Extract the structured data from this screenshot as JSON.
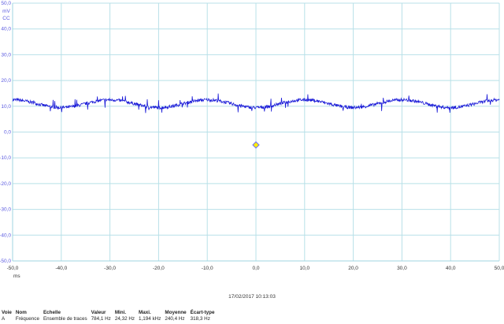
{
  "chart_data": {
    "type": "line",
    "title": "",
    "xlabel": "ms",
    "ylabel": "mV",
    "y_coupling": "CC",
    "xlim": [
      -50,
      50
    ],
    "ylim": [
      -50,
      50
    ],
    "grid": true,
    "x_ticks": [
      "-50,0",
      "-40,0",
      "-30,0",
      "-20,0",
      "-10,0",
      "0,0",
      "10,0",
      "20,0",
      "30,0",
      "40,0",
      "50,0"
    ],
    "y_ticks": [
      "50,0",
      "40,0",
      "30,0",
      "20,0",
      "10,0",
      "0,0",
      "-10,0",
      "-20,0",
      "-30,0",
      "-40,0",
      "-50,0"
    ],
    "series": [
      {
        "name": "A",
        "color": "#1a1ad8",
        "mean": 11,
        "amplitude": 1.5,
        "period_ms": 20,
        "peak_at_ms": -30,
        "noise": 0.6
      }
    ],
    "trigger_marker": {
      "x": 0,
      "y": -5,
      "color": "#ffee00"
    }
  },
  "timestamp": "17/02/2017 10:13:03",
  "measurements": {
    "headers": [
      "Voie",
      "Nom",
      "Echelle",
      "Valeur",
      "Mini.",
      "Maxi.",
      "Moyenne",
      "Écart-type"
    ],
    "rows": [
      [
        "A",
        "Fréquence",
        "Ensemble de traces",
        "784,1 Hz",
        "24,32 Hz",
        "1,194 kHz",
        "240,4 Hz",
        "318,3 Hz"
      ]
    ]
  }
}
